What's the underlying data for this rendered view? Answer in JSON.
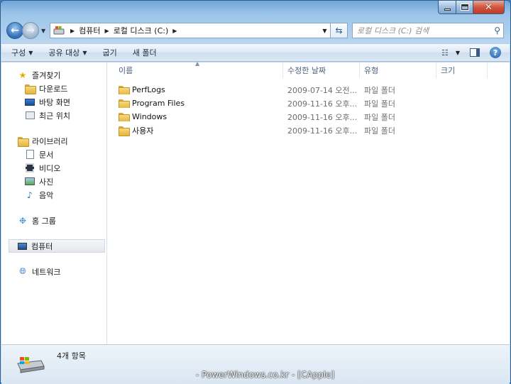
{
  "window": {
    "caption_buttons": {
      "minimize": "minimize-icon",
      "maximize": "maximize-icon",
      "close": "close-icon"
    }
  },
  "address": {
    "crumbs": [
      "컴퓨터",
      "로컬 디스크 (C:)"
    ],
    "search_placeholder": "로컬 디스크 (C:) 검색"
  },
  "toolbar": {
    "organize": "구성",
    "share": "공유 대상",
    "burn": "굽기",
    "new_folder": "새 폴더"
  },
  "navpane": {
    "favorites": {
      "label": "즐겨찾기",
      "items": [
        "다운로드",
        "바탕 화면",
        "최근 위치"
      ]
    },
    "libraries": {
      "label": "라이브러리",
      "items": [
        "문서",
        "비디오",
        "사진",
        "음악"
      ]
    },
    "homegroup": "홈 그룹",
    "computer": "컴퓨터",
    "network": "네트워크"
  },
  "columns": {
    "name": "이름",
    "date": "수정한 날짜",
    "type": "유형",
    "size": "크기"
  },
  "files": [
    {
      "name": "PerfLogs",
      "date": "2009-07-14 오전...",
      "type": "파일 폴더"
    },
    {
      "name": "Program Files",
      "date": "2009-11-16 오후...",
      "type": "파일 폴더"
    },
    {
      "name": "Windows",
      "date": "2009-11-16 오후...",
      "type": "파일 폴더"
    },
    {
      "name": "사용자",
      "date": "2009-11-16 오후...",
      "type": "파일 폴더"
    }
  ],
  "status": {
    "count": "4개 항목"
  },
  "watermark": "- PowerWindows.co.kr - [CApple]"
}
